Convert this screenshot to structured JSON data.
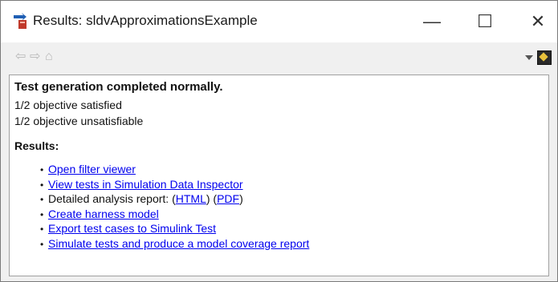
{
  "window": {
    "title": "Results: sldvApproximationsExample",
    "minimize_symbol": "—",
    "maximize_symbol": "☐",
    "close_symbol": "✕"
  },
  "toolbar": {
    "back_symbol": "⇦",
    "forward_symbol": "⇨",
    "home_symbol": "⌂"
  },
  "summary": {
    "heading": "Test generation completed normally.",
    "line1": "1/2 objective satisfied",
    "line2": "1/2 objective unsatisfiable"
  },
  "results": {
    "label": "Results:",
    "bullet": "•",
    "items": {
      "filter_viewer": "Open filter viewer",
      "view_tests": "View tests in Simulation Data Inspector",
      "report_prefix": "Detailed analysis report: (",
      "report_html": "HTML",
      "report_mid": ") (",
      "report_pdf": "PDF",
      "report_suffix": ")",
      "harness": "Create harness model",
      "export": "Export test cases to Simulink Test",
      "simulate": "Simulate tests and produce a model coverage report"
    }
  },
  "colors": {
    "link": "#0000ee",
    "icon_arrow": "#1f5fb4",
    "icon_body": "#c0392b"
  },
  "icons": {
    "app": "simulink-results-icon",
    "panel": "dock-panel-icon"
  }
}
